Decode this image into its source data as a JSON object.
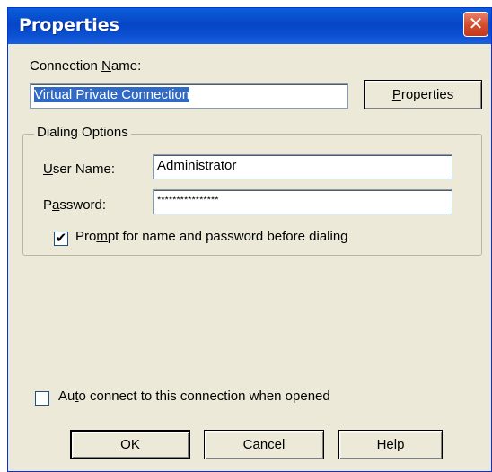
{
  "window": {
    "title": "Properties",
    "close_glyph": "✕"
  },
  "connection": {
    "label_pre": "Connection ",
    "label_acc": "N",
    "label_post": "ame:",
    "value": "Virtual Private Connection",
    "properties_pre": "",
    "properties_acc": "P",
    "properties_post": "roperties"
  },
  "dialing": {
    "group_title": "Dialing Options",
    "user_label_acc": "U",
    "user_label_post": "ser Name:",
    "user_value": "Administrator",
    "password_label_pre": "P",
    "password_label_acc": "a",
    "password_label_post": "ssword:",
    "password_value": "****************",
    "prompt_checked": true,
    "prompt_check_glyph": "✔",
    "prompt_pre": "Pro",
    "prompt_acc": "m",
    "prompt_post": "pt for name and password before dialing"
  },
  "autoconnect": {
    "checked": false,
    "pre": "Au",
    "acc": "t",
    "post": "o connect to this connection when opened"
  },
  "buttons": {
    "ok_acc": "O",
    "ok_post": "K",
    "cancel_acc": "C",
    "cancel_post": "ancel",
    "help_acc": "H",
    "help_post": "elp"
  }
}
